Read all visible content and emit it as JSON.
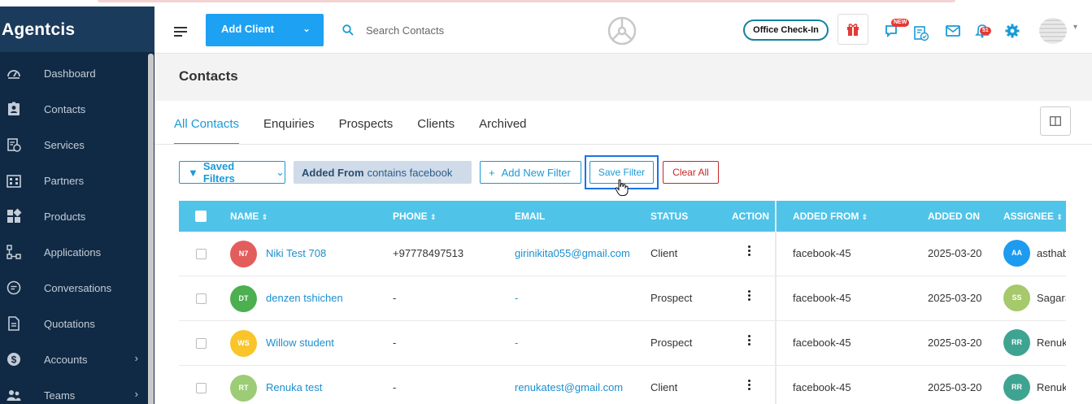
{
  "brand": "Agentcis",
  "sidebar": {
    "items": [
      {
        "label": "Dashboard",
        "icon": "dashboard-icon",
        "chevron": false
      },
      {
        "label": "Contacts",
        "icon": "contacts-icon",
        "chevron": false
      },
      {
        "label": "Services",
        "icon": "services-icon",
        "chevron": false
      },
      {
        "label": "Partners",
        "icon": "partners-icon",
        "chevron": false
      },
      {
        "label": "Products",
        "icon": "products-icon",
        "chevron": false
      },
      {
        "label": "Applications",
        "icon": "applications-icon",
        "chevron": false
      },
      {
        "label": "Conversations",
        "icon": "conversations-icon",
        "chevron": false
      },
      {
        "label": "Quotations",
        "icon": "quotations-icon",
        "chevron": false
      },
      {
        "label": "Accounts",
        "icon": "accounts-icon",
        "chevron": true
      },
      {
        "label": "Teams",
        "icon": "teams-icon",
        "chevron": true
      }
    ]
  },
  "header": {
    "add_client": "Add Client",
    "search_placeholder": "Search Contacts",
    "office_checkin": "Office Check-In",
    "new_badge": "NEW",
    "notif_count": "51"
  },
  "page": {
    "title": "Contacts"
  },
  "tabs": [
    "All Contacts",
    "Enquiries",
    "Prospects",
    "Clients",
    "Archived"
  ],
  "filters": {
    "saved_filters": "Saved Filters",
    "chip_field": "Added From",
    "chip_rest": "contains facebook",
    "add_new_filter": "Add New Filter",
    "save_filter": "Save Filter",
    "clear_all": "Clear All"
  },
  "table": {
    "columns": [
      "NAME",
      "PHONE",
      "EMAIL",
      "STATUS",
      "ACTION",
      "ADDED FROM",
      "ADDED ON",
      "ASSIGNEE"
    ],
    "rows": [
      {
        "initials": "N7",
        "color": "#e35d5d",
        "name": "Niki Test 708",
        "phone": "+97778497513",
        "email": "girinikita055@gmail.com",
        "status": "Client",
        "added_from": "facebook-45",
        "added_on": "2025-03-20",
        "assignee_initials": "AA",
        "assignee_color": "#1d9bf0",
        "assignee": "asthab"
      },
      {
        "initials": "DT",
        "color": "#4caf50",
        "name": "denzen tshichen",
        "phone": "-",
        "email": "-",
        "status": "Prospect",
        "added_from": "facebook-45",
        "added_on": "2025-03-20",
        "assignee_initials": "SS",
        "assignee_color": "#a5c96b",
        "assignee": "SagarS"
      },
      {
        "initials": "WS",
        "color": "#f9c52b",
        "name": "Willow student",
        "phone": "-",
        "email": "-",
        "status": "Prospect",
        "added_from": "facebook-45",
        "added_on": "2025-03-20",
        "assignee_initials": "RR",
        "assignee_color": "#3fa392",
        "assignee": "Renuk"
      },
      {
        "initials": "RT",
        "color": "#9ccc75",
        "name": "Renuka test",
        "phone": "-",
        "email": "renukatest@gmail.com",
        "status": "Client",
        "added_from": "facebook-45",
        "added_on": "2025-03-20",
        "assignee_initials": "RR",
        "assignee_color": "#3fa392",
        "assignee": "Renuk"
      }
    ]
  }
}
